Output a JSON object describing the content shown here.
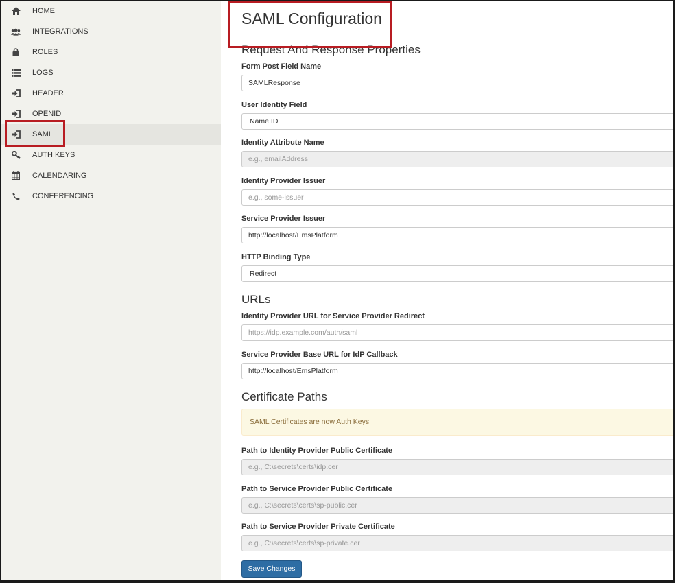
{
  "sidebar": {
    "items": [
      {
        "label": "HOME",
        "icon": "home-icon"
      },
      {
        "label": "INTEGRATIONS",
        "icon": "users-icon"
      },
      {
        "label": "ROLES",
        "icon": "lock-icon"
      },
      {
        "label": "LOGS",
        "icon": "list-icon"
      },
      {
        "label": "HEADER",
        "icon": "sign-in-icon"
      },
      {
        "label": "OPENID",
        "icon": "sign-in-icon"
      },
      {
        "label": "SAML",
        "icon": "sign-in-icon",
        "active": true
      },
      {
        "label": "AUTH KEYS",
        "icon": "key-icon"
      },
      {
        "label": "CALENDARING",
        "icon": "calendar-icon"
      },
      {
        "label": "CONFERENCING",
        "icon": "phone-icon"
      }
    ]
  },
  "page": {
    "title": "SAML Configuration"
  },
  "sections": {
    "request_response": "Request And Response Properties",
    "urls": "URLs",
    "certificates": "Certificate Paths"
  },
  "fields": {
    "form_post_field_name": {
      "label": "Form Post Field Name",
      "value": "SAMLResponse"
    },
    "user_identity_field": {
      "label": "User Identity Field",
      "value": "Name ID"
    },
    "identity_attribute_name": {
      "label": "Identity Attribute Name",
      "placeholder": "e.g., emailAddress"
    },
    "identity_provider_issuer": {
      "label": "Identity Provider Issuer",
      "placeholder": "e.g., some-issuer"
    },
    "service_provider_issuer": {
      "label": "Service Provider Issuer",
      "value": "http://localhost/EmsPlatform"
    },
    "http_binding_type": {
      "label": "HTTP Binding Type",
      "value": "Redirect"
    },
    "idp_url": {
      "label": "Identity Provider URL for Service Provider Redirect",
      "placeholder": "https://idp.example.com/auth/saml"
    },
    "sp_base_url": {
      "label": "Service Provider Base URL for IdP Callback",
      "value": "http://localhost/EmsPlatform"
    },
    "idp_public_cert": {
      "label": "Path to Identity Provider Public Certificate",
      "placeholder": "e.g., C:\\secrets\\certs\\idp.cer"
    },
    "sp_public_cert": {
      "label": "Path to Service Provider Public Certificate",
      "placeholder": "e.g., C:\\secrets\\certs\\sp-public.cer"
    },
    "sp_private_cert": {
      "label": "Path to Service Provider Private Certificate",
      "placeholder": "e.g., C:\\secrets\\certs\\sp-private.cer"
    }
  },
  "alert": {
    "text": "SAML Certificates are now Auth Keys"
  },
  "actions": {
    "save_label": "Save Changes"
  },
  "colors": {
    "sidebar_bg": "#f2f2ed",
    "highlight_border": "#b81c22",
    "primary_button": "#2e6da4",
    "alert_bg": "#fcf8e3",
    "alert_text": "#8a6d3b"
  }
}
